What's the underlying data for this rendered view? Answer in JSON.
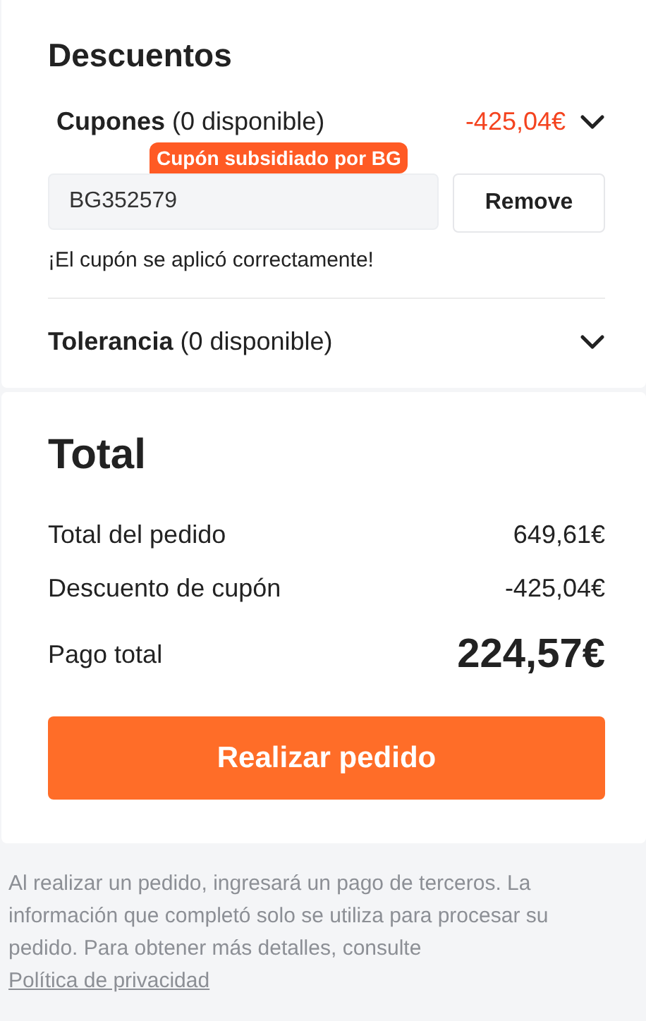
{
  "discounts": {
    "title": "Descuentos",
    "coupons": {
      "label": "**Cupones** (0 disponible)",
      "amount": "-425,04€",
      "badge": "Cupón subsidiado por BG",
      "code": "BG352579",
      "button": "Remove",
      "message": "¡El cupón se aplicó correctamente!"
    },
    "tolerance": {
      "label": "**Tolerancia** (0 disponible)"
    }
  },
  "total": {
    "title": "Total",
    "rows": [
      {
        "label": "Total del pedido",
        "value": "649,61€",
        "kind": "normal"
      },
      {
        "label": "Descuento de cupón",
        "value": "-425,04€",
        "kind": "normal"
      },
      {
        "label": "Pago total",
        "value": "224,57€",
        "kind": "grand"
      }
    ],
    "button": "Realizar pedido"
  },
  "notice": {
    "text": "Al realizar un pedido, ingresará un pago de terceros. La información que completó solo se utiliza para procesar su pedido. Para obtener más detalles, consulte",
    "link": "Política de privacidad"
  }
}
